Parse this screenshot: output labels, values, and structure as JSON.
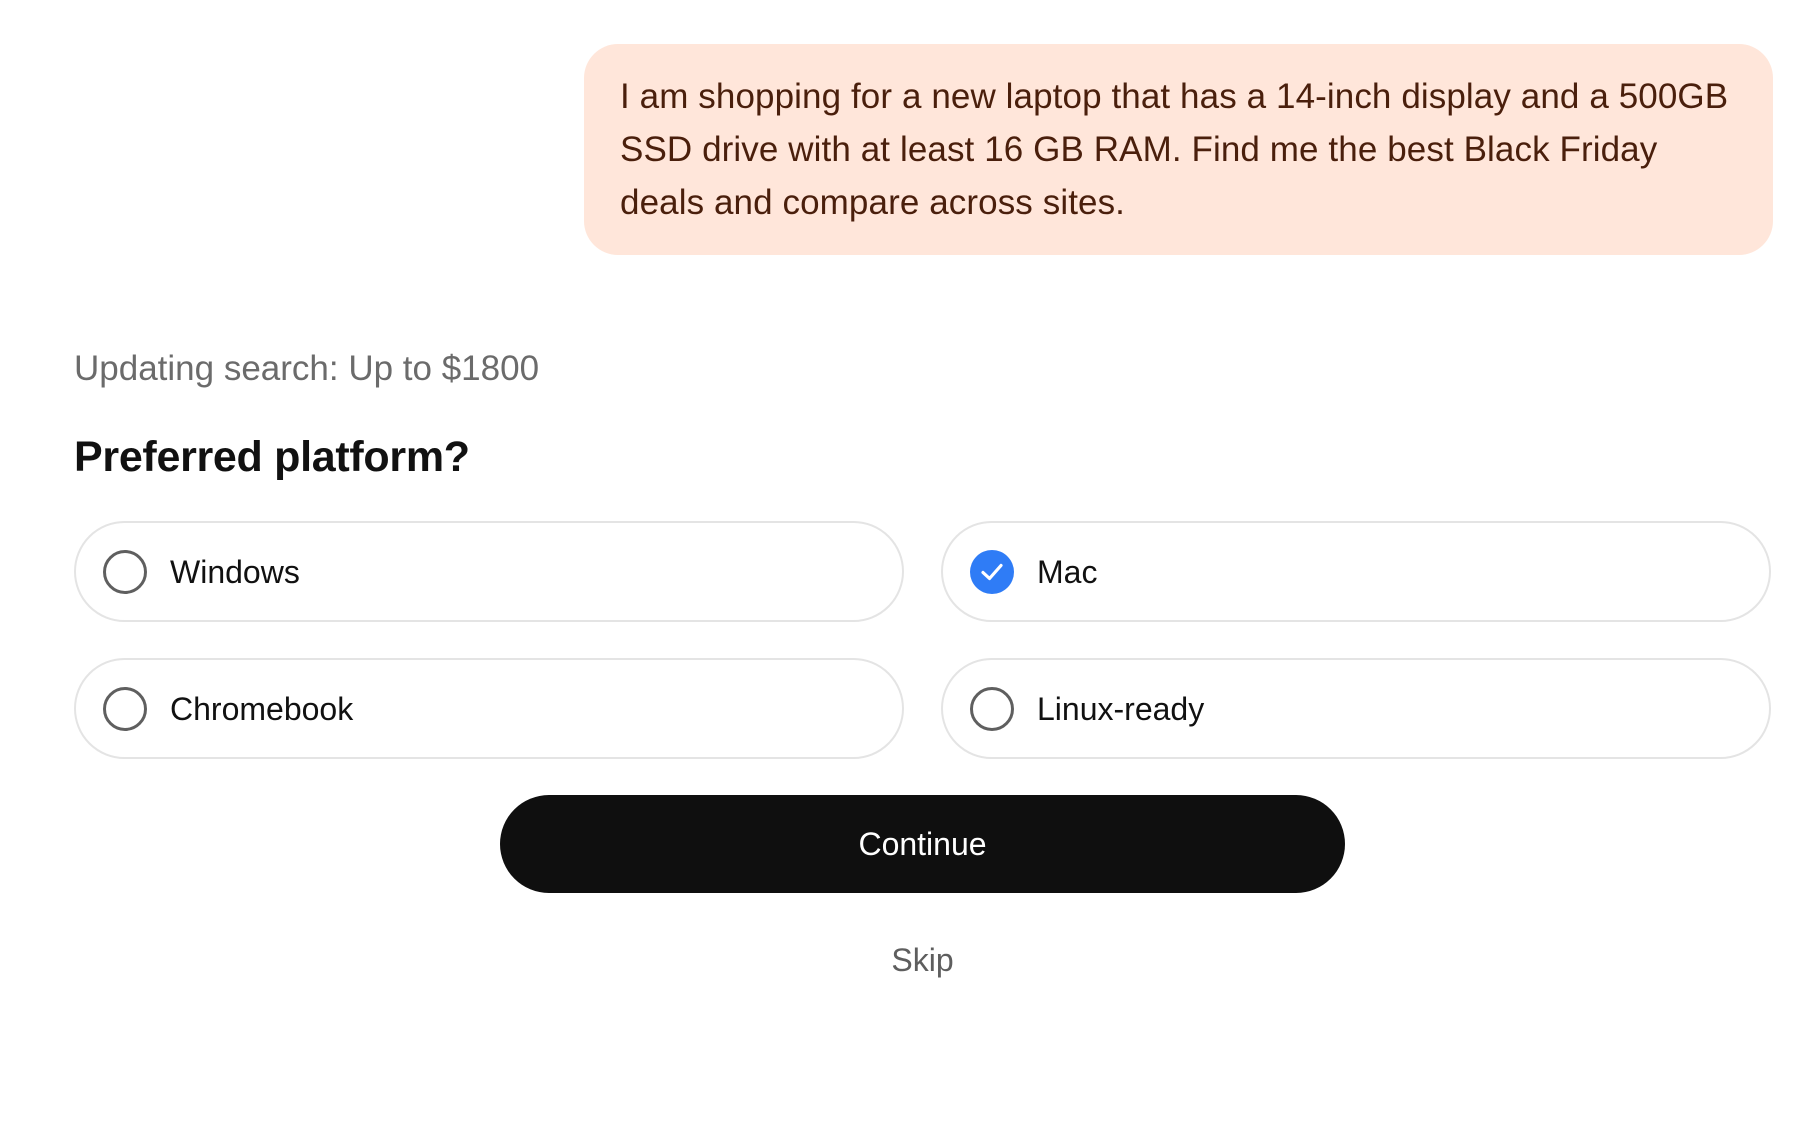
{
  "conversation": {
    "user_message": "I am shopping for a new laptop that has a 14-inch display and a 500GB SSD drive with at least 16 GB RAM. Find me the best Black Friday deals and compare across sites."
  },
  "search_status": "Updating search: Up to $1800",
  "question": {
    "title": "Preferred platform?",
    "options": [
      {
        "label": "Windows",
        "selected": false
      },
      {
        "label": "Mac",
        "selected": true
      },
      {
        "label": "Chromebook",
        "selected": false
      },
      {
        "label": "Linux-ready",
        "selected": false
      }
    ]
  },
  "actions": {
    "continue_label": "Continue",
    "skip_label": "Skip"
  },
  "colors": {
    "bubble_background": "#ffe6da",
    "bubble_text": "#4a1f0c",
    "selected_accent": "#2f7cf6",
    "primary_button": "#0f0f0f"
  },
  "icons": {
    "selected": "checkmark-icon",
    "unselected": "radio-circle-icon"
  }
}
